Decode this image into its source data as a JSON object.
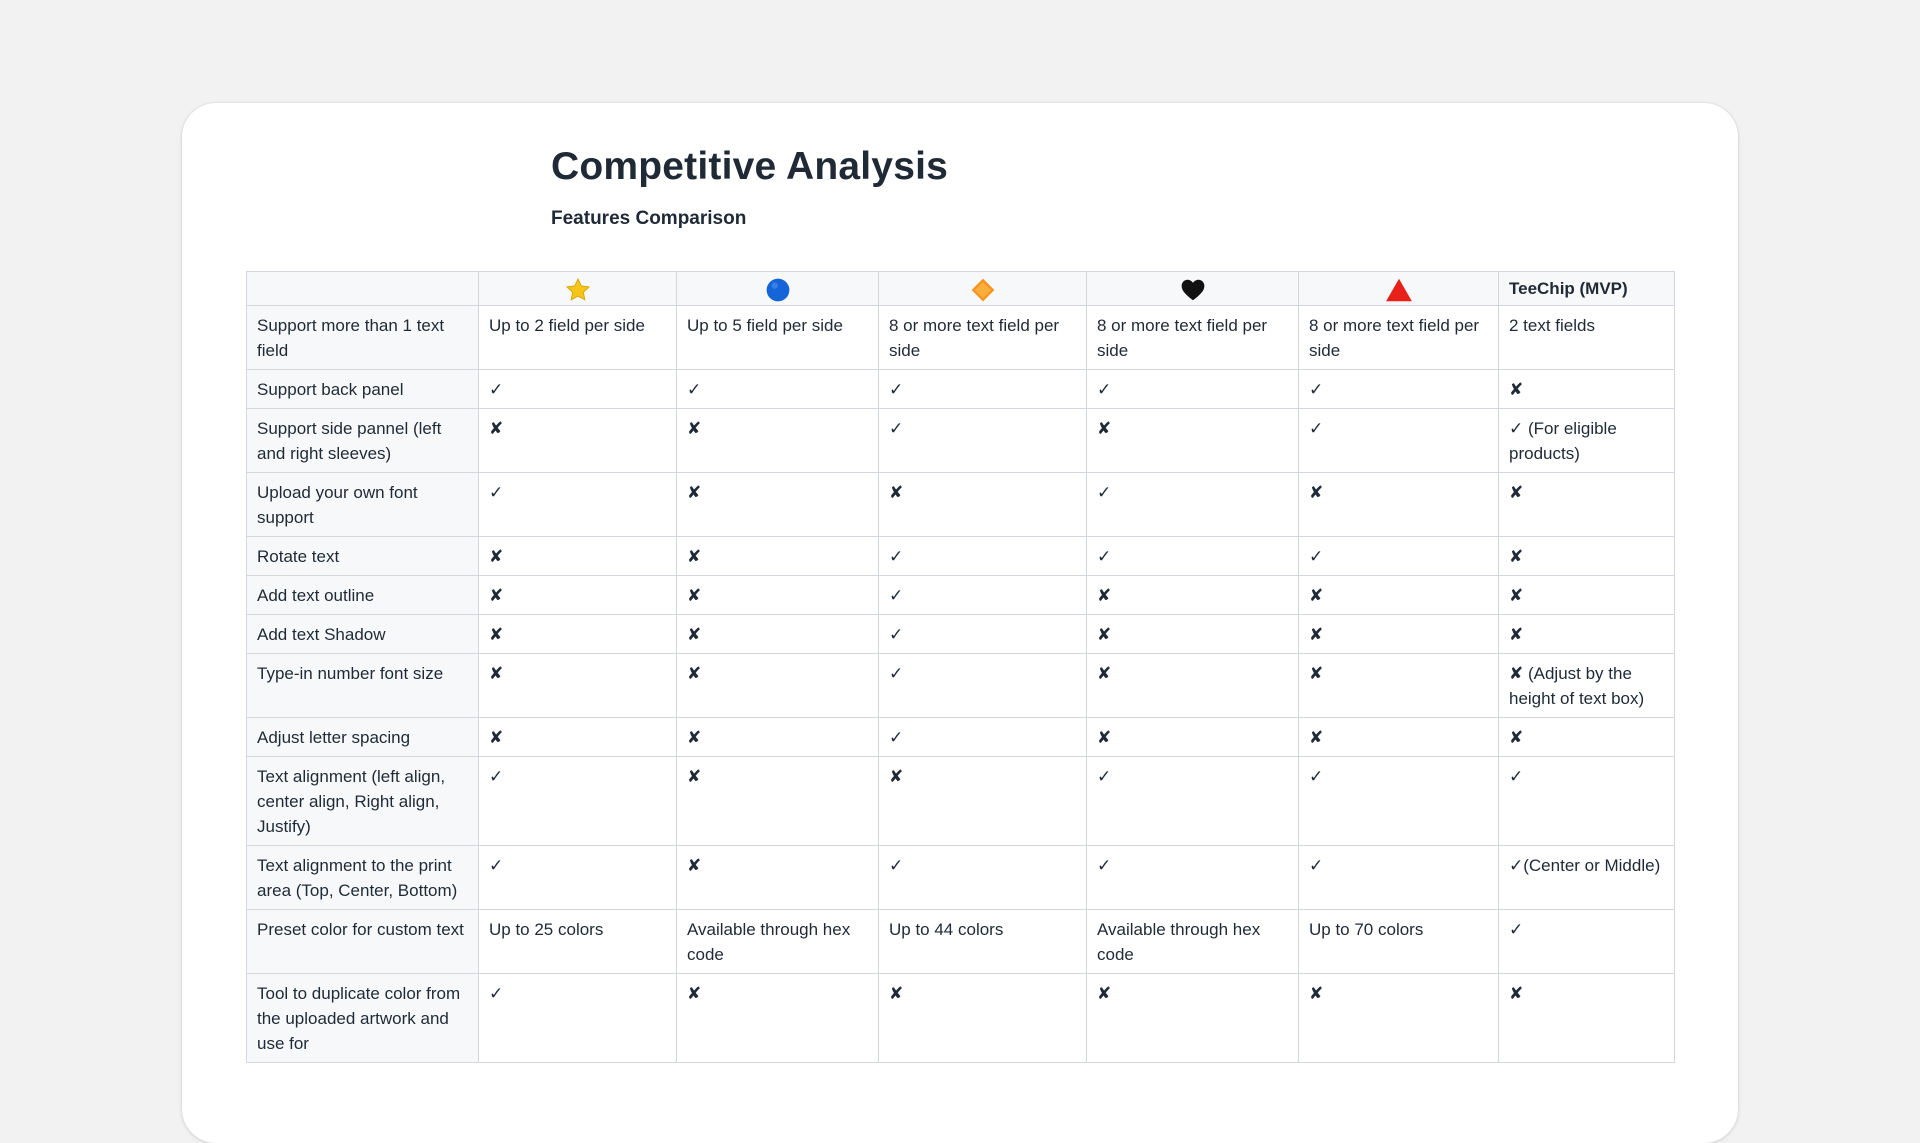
{
  "document": {
    "title": "Competitive Analysis",
    "subtitle": "Features Comparison"
  },
  "table": {
    "columns": [
      {
        "icon": "star-icon",
        "color": "#f5c518"
      },
      {
        "icon": "blue-circle-icon",
        "color": "#1565d8"
      },
      {
        "icon": "orange-diamond-icon",
        "color": "#f7941d"
      },
      {
        "icon": "black-heart-icon",
        "color": "#111111"
      },
      {
        "icon": "red-triangle-icon",
        "color": "#e8201a"
      },
      {
        "label": "TeeChip (MVP)"
      }
    ],
    "rows": [
      {
        "feature": "Support more than 1 text field",
        "cells": [
          "Up to 2 field per side",
          "Up to 5 field per side",
          "8 or more text field per side",
          "8 or more text field per side",
          "8 or more text field per side",
          "2 text fields"
        ]
      },
      {
        "feature": "Support back panel",
        "cells": [
          "✓",
          "✓",
          "✓",
          "✓",
          "✓",
          "✘"
        ]
      },
      {
        "feature": "Support side pannel (left and right sleeves)",
        "cells": [
          "✘",
          "✘",
          "✓",
          "✘",
          "✓",
          "✓ (For eligible products)"
        ]
      },
      {
        "feature": "Upload your own font support",
        "cells": [
          "✓",
          "✘",
          "✘",
          "✓",
          "✘",
          "✘"
        ]
      },
      {
        "feature": "Rotate text",
        "cells": [
          "✘",
          "✘",
          "✓",
          "✓",
          "✓",
          "✘"
        ]
      },
      {
        "feature": "Add text outline",
        "cells": [
          "✘",
          "✘",
          "✓",
          "✘",
          "✘",
          "✘"
        ]
      },
      {
        "feature": "Add text Shadow",
        "cells": [
          "✘",
          "✘",
          "✓",
          "✘",
          "✘",
          "✘"
        ]
      },
      {
        "feature": "Type-in number font size",
        "cells": [
          "✘",
          "✘",
          "✓",
          "✘",
          "✘",
          "✘ (Adjust by the height of text box)"
        ]
      },
      {
        "feature": "Adjust letter spacing",
        "cells": [
          "✘",
          "✘",
          "✓",
          "✘",
          "✘",
          "✘"
        ]
      },
      {
        "feature": "Text alignment (left align, center align, Right align, Justify)",
        "cells": [
          "✓",
          "✘",
          "✘",
          "✓",
          "✓",
          "✓"
        ]
      },
      {
        "feature": "Text alignment to the print area (Top, Center, Bottom)",
        "cells": [
          "✓",
          "✘",
          "✓",
          "✓",
          "✓",
          "✓(Center or Middle)"
        ]
      },
      {
        "feature": "Preset color for custom text",
        "cells": [
          "Up to 25 colors",
          "Available through hex code",
          "Up to 44 colors",
          "Available through hex code",
          "Up to 70 colors",
          "✓"
        ]
      },
      {
        "feature": "Tool to duplicate color from the uploaded artwork and use for",
        "cells": [
          "✓",
          "✘",
          "✘",
          "✘",
          "✘",
          "✘"
        ]
      }
    ]
  }
}
